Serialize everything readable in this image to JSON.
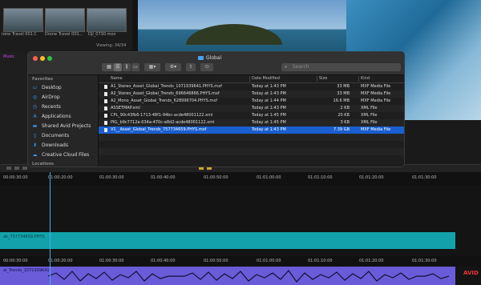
{
  "bin": {
    "thumbs": [
      {
        "label": "rone Travel 001.C"
      },
      {
        "label": "Drone Travel 001..."
      },
      {
        "label": "DJI_0730.mov"
      }
    ],
    "viewing": "Viewing: 34/34"
  },
  "music_tab": "Music",
  "timeline": {
    "timecodes": [
      "00:00:30:00",
      "01:00:20:00",
      "01:00:30:00",
      "01:00:40:00",
      "01:00:50:00",
      "01:01:00:00",
      "01:01:10:00",
      "01:01:20:00",
      "01:01:30:00"
    ],
    "video_track_label": "ak_757734659.PHYS",
    "audio_track_label": "al_Trends_1071939641",
    "logo": "AVID"
  },
  "finder": {
    "title": "Global",
    "search_placeholder": "Search",
    "sidebar": {
      "favorites_heading": "Favorites",
      "items": [
        {
          "label": "Desktop",
          "icon": "desktop-icon"
        },
        {
          "label": "AirDrop",
          "icon": "airdrop-icon"
        },
        {
          "label": "Recents",
          "icon": "clock-icon"
        },
        {
          "label": "Applications",
          "icon": "applications-icon"
        },
        {
          "label": "Shared Avid Projects",
          "icon": "folder-icon"
        },
        {
          "label": "Documents",
          "icon": "document-icon"
        },
        {
          "label": "Downloads",
          "icon": "download-icon"
        },
        {
          "label": "Creative Cloud Files",
          "icon": "cloud-icon"
        }
      ],
      "locations_heading": "Locations"
    },
    "columns": {
      "name": "Name",
      "date": "Date Modified",
      "size": "Size",
      "kind": "Kind"
    },
    "files": [
      {
        "name": "A1_Stereo_Asset_Global_Trends_1071939641.PHYS.mxf",
        "date": "Today at 1:43 PM",
        "size": "33 MB",
        "kind": "MXF Media File"
      },
      {
        "name": "A2_Stereo_Asset_Global_Trends_696646866.PHYS.mxf",
        "date": "Today at 1:43 PM",
        "size": "33 MB",
        "kind": "MXF Media File"
      },
      {
        "name": "A2_Mono_Asset_Global_Trends_628996704.PHYS.mxf",
        "date": "Today at 1:44 PM",
        "size": "16.6 MB",
        "kind": "MXF Media File"
      },
      {
        "name": "ASSETMAP.xml",
        "date": "Today at 1:43 PM",
        "size": "2 KB",
        "kind": "XML File"
      },
      {
        "name": "CPL_90c43fb6-1713-48f1-94bc-acde48001122.xml",
        "date": "Today at 1:45 PM",
        "size": "20 KB",
        "kind": "XML File"
      },
      {
        "name": "PKL_b9c7712a-034a-470c-a8d2-acde48001122.xml",
        "date": "Today at 1:45 PM",
        "size": "3 KB",
        "kind": "XML File"
      },
      {
        "name": "V1__Asset_Global_Trends_757734659.PHYS.mxf",
        "date": "Today at 1:43 PM",
        "size": "7.39 GB",
        "kind": "MXF Media File"
      }
    ],
    "selected_index": 6
  }
}
